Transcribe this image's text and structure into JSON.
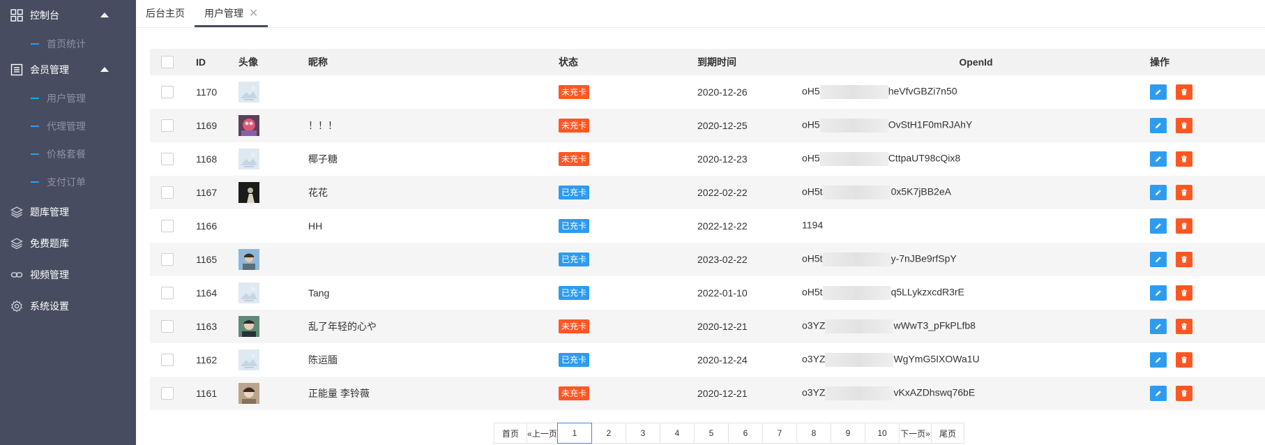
{
  "colors": {
    "sidebar_bg": "#484c60",
    "accent_blue": "#2d9cf0",
    "badge_orange": "#ff5722",
    "badge_blue": "#2d9cf0",
    "edit_blue": "#2d9cf0",
    "delete_orange": "#ff5722"
  },
  "sidebar": {
    "console": {
      "label": "控制台",
      "icon": "grid-icon"
    },
    "console_items": [
      {
        "label": "首页统计"
      }
    ],
    "member": {
      "label": "会员管理",
      "icon": "list-icon"
    },
    "member_items": [
      {
        "label": "用户管理"
      },
      {
        "label": "代理管理"
      },
      {
        "label": "价格套餐"
      },
      {
        "label": "支付订单"
      }
    ],
    "bank": {
      "label": "题库管理",
      "icon": "layers-icon"
    },
    "free_bank": {
      "label": "免费题库",
      "icon": "layers-icon"
    },
    "video": {
      "label": "视频管理",
      "icon": "link-icon"
    },
    "settings": {
      "label": "系统设置",
      "icon": "gear-icon"
    }
  },
  "tabs": [
    {
      "label": "后台主页"
    },
    {
      "label": "用户管理",
      "close": "✕"
    }
  ],
  "table": {
    "headers": {
      "id": "ID",
      "avatar": "头像",
      "nickname": "昵称",
      "status": "状态",
      "expire": "到期时间",
      "openid": "OpenId",
      "ops": "操作"
    },
    "rows": [
      {
        "id": "1170",
        "avatar": "placeholder",
        "nickname": "",
        "status": "未充卡",
        "status_kind": "unpaid",
        "expire": "2020-12-26",
        "openid_prefix": "oH5",
        "openid_suffix": "heVfvGBZi7n50"
      },
      {
        "id": "1169",
        "avatar": "photo-pink",
        "nickname": "！！！",
        "status": "未充卡",
        "status_kind": "unpaid",
        "expire": "2020-12-25",
        "openid_prefix": "oH5",
        "openid_suffix": "OvStH1F0mRJAhY"
      },
      {
        "id": "1168",
        "avatar": "placeholder",
        "nickname": "椰子糖",
        "status": "未充卡",
        "status_kind": "unpaid",
        "expire": "2020-12-23",
        "openid_prefix": "oH5",
        "openid_suffix": "CttpaUT98cQix8"
      },
      {
        "id": "1167",
        "avatar": "photo-dark",
        "nickname": "花花",
        "status": "已充卡",
        "status_kind": "paid",
        "expire": "2022-02-22",
        "openid_prefix": "oH5t",
        "openid_suffix": "0x5K7jBB2eA"
      },
      {
        "id": "1166",
        "avatar": "none",
        "nickname": "HH",
        "status": "已充卡",
        "status_kind": "paid",
        "expire": "2022-12-22",
        "openid_prefix": "1194",
        "openid_suffix": ""
      },
      {
        "id": "1165",
        "avatar": "photo-sky",
        "nickname": "",
        "status": "已充卡",
        "status_kind": "paid",
        "expire": "2023-02-22",
        "openid_prefix": "oH5t",
        "openid_suffix": "y-7nJBe9rfSpY"
      },
      {
        "id": "1164",
        "avatar": "placeholder",
        "nickname": "Tang",
        "status": "已充卡",
        "status_kind": "paid",
        "expire": "2022-01-10",
        "openid_prefix": "oH5t",
        "openid_suffix": "q5LLykzxcdR3rE"
      },
      {
        "id": "1163",
        "avatar": "photo-green",
        "nickname": "乱了年轻的心や",
        "status": "未充卡",
        "status_kind": "unpaid",
        "expire": "2020-12-21",
        "openid_prefix": "o3YZ",
        "openid_suffix": "wWwT3_pFkPLfb8"
      },
      {
        "id": "1162",
        "avatar": "placeholder",
        "nickname": "陈运腼",
        "status": "已充卡",
        "status_kind": "paid",
        "expire": "2020-12-24",
        "openid_prefix": "o3YZ",
        "openid_suffix": "WgYmG5IXOWa1U"
      },
      {
        "id": "1161",
        "avatar": "photo-face",
        "nickname": "正能量 李铃薇",
        "status": "未充卡",
        "status_kind": "unpaid",
        "expire": "2020-12-21",
        "openid_prefix": "o3YZ",
        "openid_suffix": "vKxAZDhswq76bE"
      }
    ]
  },
  "pagination": {
    "first": "首页",
    "prev": "«上一页",
    "pages": [
      "1",
      "2",
      "3",
      "4",
      "5",
      "6",
      "7",
      "8",
      "9",
      "10"
    ],
    "current": "1",
    "next": "下一页»",
    "last": "尾页"
  }
}
